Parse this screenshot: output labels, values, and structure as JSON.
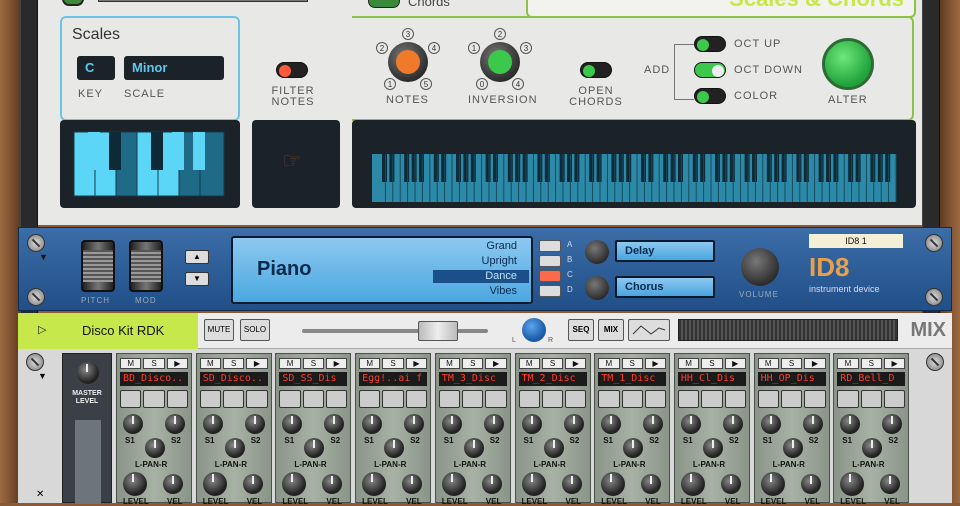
{
  "scales_chords": {
    "chords_label": "Chords",
    "brand_title": "Scales & Chords",
    "scales": {
      "title": "Scales",
      "key": "C",
      "scale": "Minor",
      "key_label": "KEY",
      "scale_label": "SCALE"
    },
    "filter_notes_label": "FILTER\nNOTES",
    "notes_label": "NOTES",
    "inversion_label": "INVERSION",
    "open_chords_label": "OPEN\nCHORDS",
    "add_label": "ADD",
    "add_options": [
      "OCT UP",
      "OCT DOWN",
      "COLOR"
    ],
    "alter_label": "ALTER",
    "notes_numbers": [
      "1",
      "2",
      "3",
      "4",
      "5"
    ],
    "inversion_numbers": [
      "0",
      "1",
      "2",
      "3",
      "4"
    ]
  },
  "id8": {
    "pitch_label": "PITCH",
    "mod_label": "MOD",
    "sound": "Piano",
    "variations": [
      "Grand",
      "Upright",
      "Dance",
      "Vibes"
    ],
    "variation_selected": "Dance",
    "variation_buttons": [
      "A",
      "B",
      "C",
      "D"
    ],
    "fx1": "Delay",
    "fx2": "Chorus",
    "volume_label": "VOLUME",
    "patch_display": "ID8 1",
    "logo": "ID8",
    "logo_sub": "instrument device"
  },
  "mixer": {
    "track_name": "Disco Kit RDK",
    "mute_label": "MUTE",
    "solo_label": "SOLO",
    "seq_label": "SEQ",
    "mix_label": "MIX",
    "big_mix_label": "MIX",
    "pan_l": "L",
    "pan_r": "R",
    "master_level_label": "MASTER\nLEVEL",
    "channel_buttons": [
      "M",
      "S",
      "▶"
    ],
    "channels": [
      "BD_Disco..",
      "SD_Disco..",
      "SD_SS_Dis",
      "Egg!..ai f",
      "TM_3_Disc",
      "TM_2_Disc",
      "TM_1_Disc",
      "HH_Cl_Dis",
      "HH_OP_Dis",
      "RD_Bell_D"
    ],
    "s1_label": "S1",
    "s2_label": "S2",
    "pan_label": "L-PAN-R",
    "level_label": "LEVEL",
    "vel_label": "VEL"
  },
  "colors": {
    "accent_blue": "#6cc3e8",
    "accent_green": "#8bc34a",
    "lcd_red": "#ff3b2f",
    "yellow_green": "#c6e84a"
  }
}
